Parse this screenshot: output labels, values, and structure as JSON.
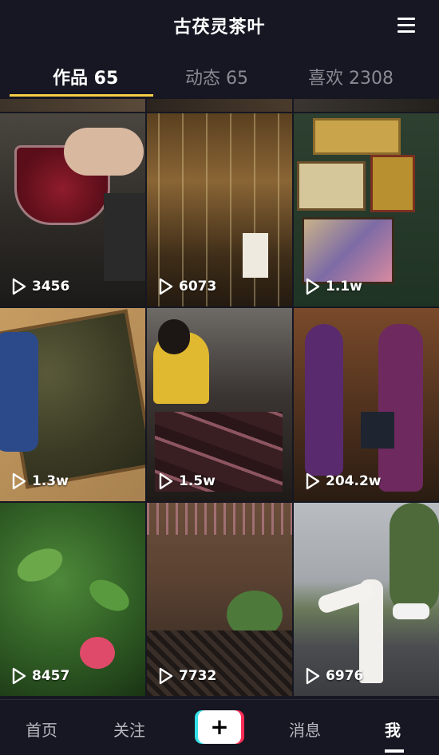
{
  "header": {
    "title": "古茯灵茶叶",
    "menu_icon": "hamburger-menu-icon"
  },
  "tabs": [
    {
      "label": "作品 65",
      "active": true
    },
    {
      "label": "动态 65",
      "active": false
    },
    {
      "label": "喜欢 2308",
      "active": false
    }
  ],
  "videos": [
    {
      "views": "3456",
      "thumbnail": "tea-glass-on-counter"
    },
    {
      "views": "6073",
      "thumbnail": "tea-shop-hanging-signs"
    },
    {
      "views": "1.1w",
      "thumbnail": "award-plaques-wall"
    },
    {
      "views": "1.3w",
      "thumbnail": "fu-brick-tea-block"
    },
    {
      "views": "1.5w",
      "thumbnail": "woman-packing-tea-boxes"
    },
    {
      "views": "204.2w",
      "thumbnail": "women-in-tea-shop"
    },
    {
      "views": "8457",
      "thumbnail": "green-plant-pink-flowers"
    },
    {
      "views": "7732",
      "thumbnail": "courtyard-tea-house"
    },
    {
      "views": "6976",
      "thumbnail": "woman-dancing-on-street"
    }
  ],
  "bottom_nav": {
    "home": "首页",
    "follow": "关注",
    "create_icon": "plus-icon",
    "messages": "消息",
    "me": "我"
  },
  "colors": {
    "background": "#161722",
    "tab_indicator": "#f6ce46",
    "plus_red": "#fe2c55",
    "plus_cyan": "#35e0e8"
  }
}
